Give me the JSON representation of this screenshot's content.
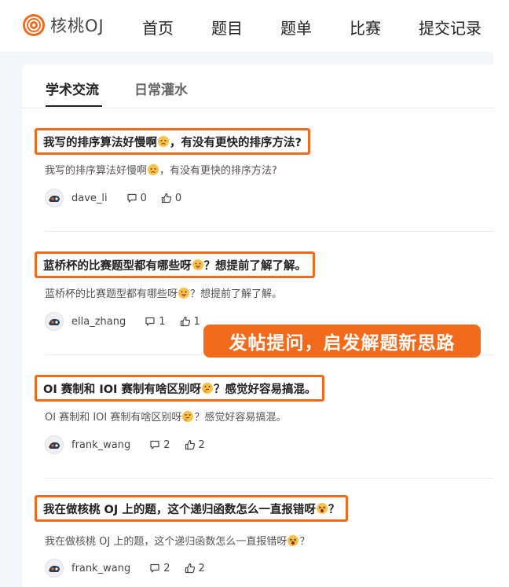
{
  "header": {
    "logo_text": "核桃OJ",
    "nav": [
      "首页",
      "题目",
      "题单",
      "比赛",
      "提交记录"
    ]
  },
  "tabs": [
    {
      "label": "学术交流",
      "active": true
    },
    {
      "label": "日常灌水",
      "active": false
    }
  ],
  "posts": [
    {
      "title_before": "我写的排序算法好慢啊",
      "title_after": "，有没有更快的排序方法?",
      "summary_before": "我写的排序算法好慢啊",
      "summary_after": "，有没有更快的排序方法?",
      "emoji": "worried",
      "author": "dave_li",
      "comments": "0",
      "likes": "0"
    },
    {
      "title_before": "蓝桥杯的比赛题型都有哪些呀",
      "title_after": "？想提前了解了解。",
      "summary_before": "蓝桥杯的比赛题型都有哪些呀",
      "summary_after": "？想提前了解了解。",
      "emoji": "playful",
      "author": "ella_zhang",
      "comments": "1",
      "likes": "1"
    },
    {
      "title_before": "OI 赛制和 IOI 赛制有啥区别呀",
      "title_after": "？感觉好容易搞混。",
      "summary_before": "OI 赛制和 IOI 赛制有啥区别呀",
      "summary_after": "？感觉好容易搞混。",
      "emoji": "thinking",
      "author": "frank_wang",
      "comments": "2",
      "likes": "2"
    },
    {
      "title_before": "我在做核桃 OJ 上的题，这个递归函数怎么一直报错呀",
      "title_after": "？",
      "summary_before": "我在做核桃 OJ 上的题，这个递归函数怎么一直报错呀",
      "summary_after": "？",
      "emoji": "shocked",
      "author": "frank_wang",
      "comments": "2",
      "likes": "2"
    }
  ],
  "promo_banner": "发帖提问，启发解题新思路",
  "colors": {
    "accent": "#f26a1b",
    "page_bg": "#f3f6fb"
  }
}
